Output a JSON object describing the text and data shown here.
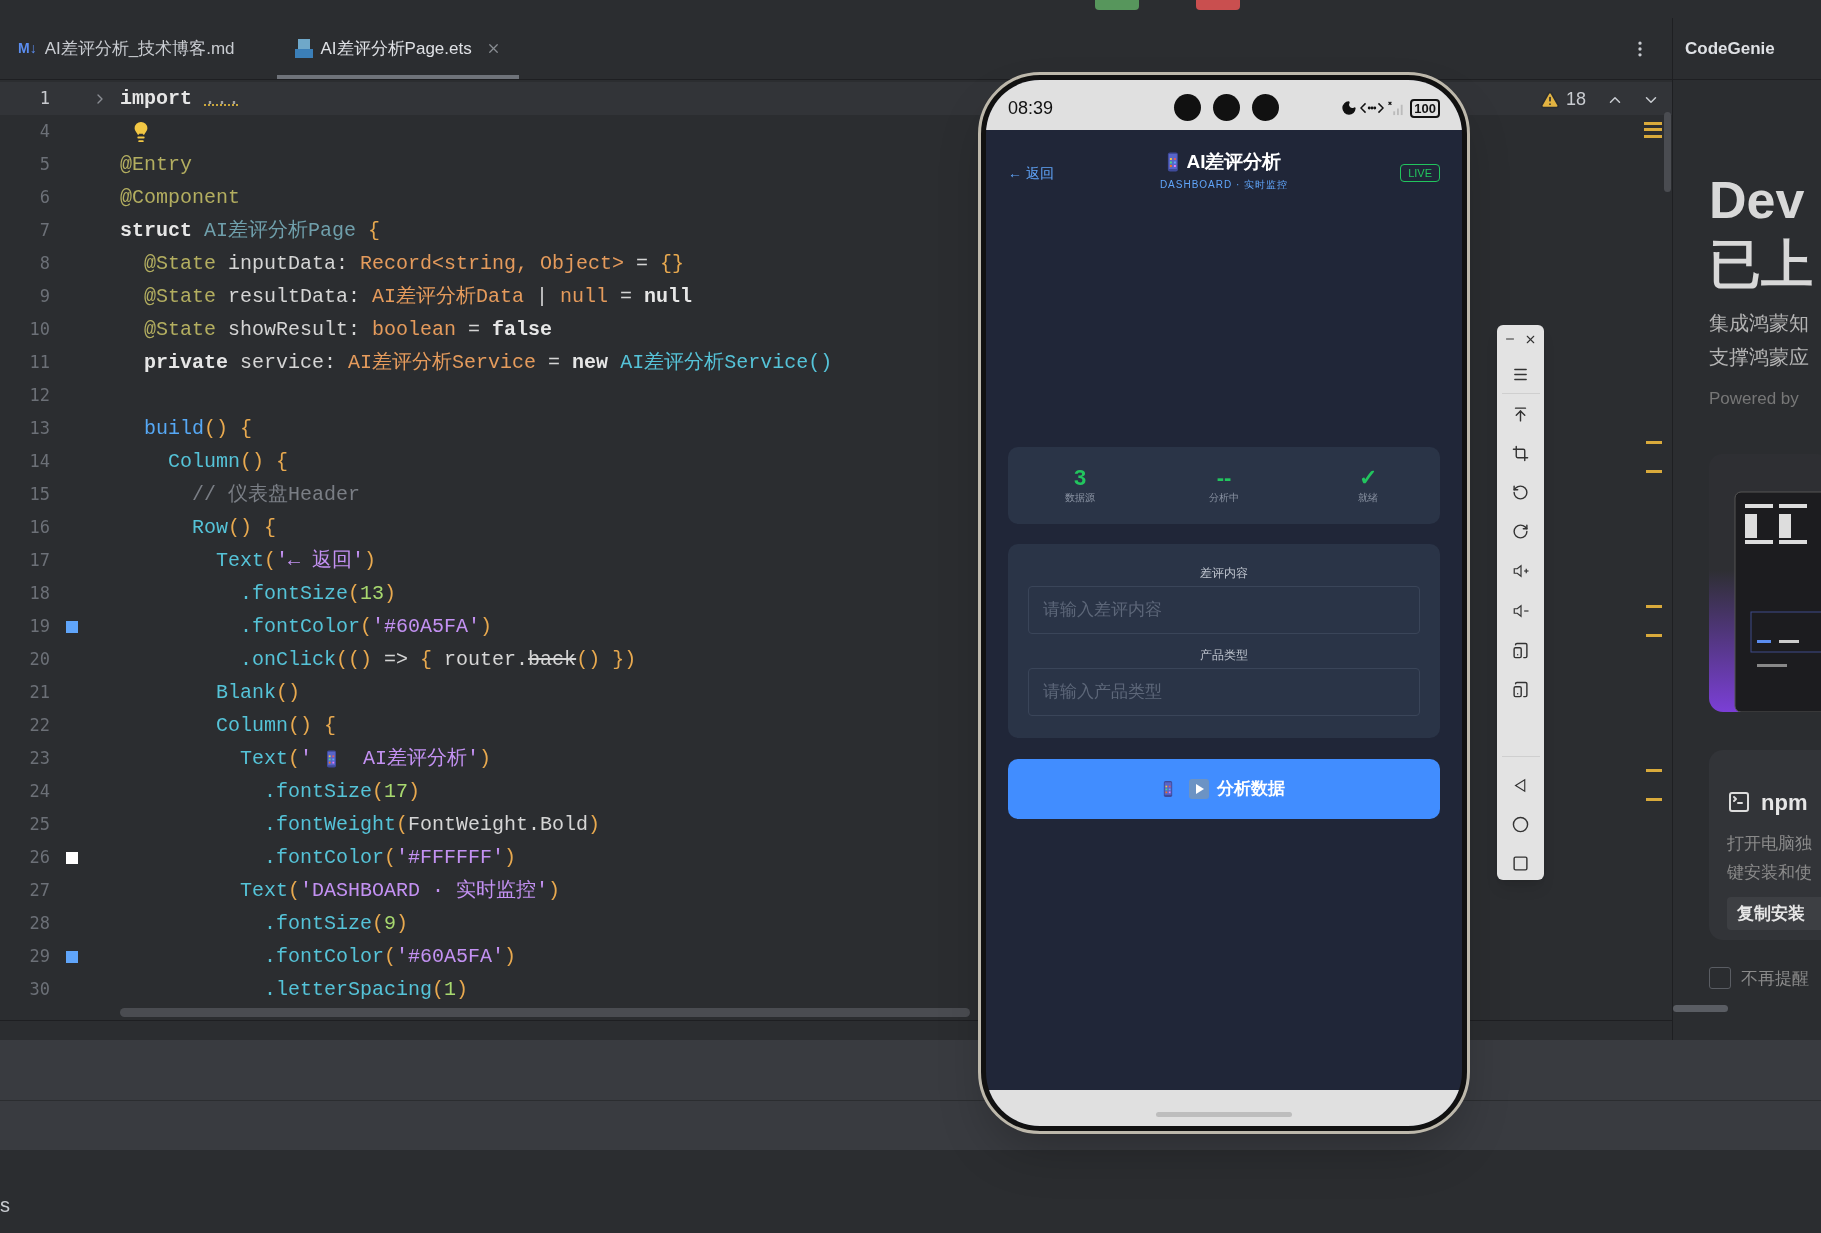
{
  "editor_tabs": [
    {
      "icon_text": "M↓",
      "label": "AI差评分析_技术博客.md",
      "selected": false,
      "closable": false
    },
    {
      "label": "AI差评分析Page.ets",
      "selected": true,
      "closable": true
    }
  ],
  "warnings": {
    "count": "18"
  },
  "code_lines": [
    {
      "number": "1",
      "current": true,
      "kind": "fold",
      "tokens": [
        {
          "kind": "kw",
          "text": "import "
        },
        {
          "kind": "fold",
          "text": "..."
        }
      ]
    },
    {
      "number": "4",
      "current": false,
      "kind": "bulb"
    },
    {
      "number": "5",
      "current": false,
      "tokens": [
        {
          "kind": "dec",
          "text": "@Entry"
        }
      ]
    },
    {
      "number": "6",
      "current": false,
      "tokens": [
        {
          "kind": "dec",
          "text": "@Component"
        }
      ]
    },
    {
      "number": "7",
      "current": false,
      "tokens": [
        {
          "kind": "kw",
          "text": "struct "
        },
        {
          "kind": "cls",
          "text": "AI差评分析Page"
        },
        {
          "kind": "brace",
          "text": " {"
        }
      ]
    },
    {
      "number": "8",
      "current": false,
      "tokens": [
        {
          "kind": "dec",
          "text": "  @State"
        },
        {
          "kind": "txt",
          "text": " inputData: "
        },
        {
          "kind": "type",
          "text": "Record<string, Object>"
        },
        {
          "kind": "txt",
          "text": " = "
        },
        {
          "kind": "brace",
          "text": "{}"
        }
      ]
    },
    {
      "number": "9",
      "current": false,
      "tokens": [
        {
          "kind": "dec",
          "text": "  @State"
        },
        {
          "kind": "txt",
          "text": " resultData: "
        },
        {
          "kind": "type",
          "text": "AI差评分析Data"
        },
        {
          "kind": "txt",
          "text": " | "
        },
        {
          "kind": "type",
          "text": "null"
        },
        {
          "kind": "txt",
          "text": " = "
        },
        {
          "kind": "kw",
          "text": "null"
        }
      ]
    },
    {
      "number": "10",
      "current": false,
      "tokens": [
        {
          "kind": "dec",
          "text": "  @State"
        },
        {
          "kind": "txt",
          "text": " showResult: "
        },
        {
          "kind": "type",
          "text": "boolean"
        },
        {
          "kind": "txt",
          "text": " = "
        },
        {
          "kind": "kw",
          "text": "false"
        }
      ]
    },
    {
      "number": "11",
      "current": false,
      "tokens": [
        {
          "kind": "kw",
          "text": "  private"
        },
        {
          "kind": "txt",
          "text": " service: "
        },
        {
          "kind": "type",
          "text": "AI差评分析Service"
        },
        {
          "kind": "txt",
          "text": " = "
        },
        {
          "kind": "kw",
          "text": "new "
        },
        {
          "kind": "fn",
          "text": "AI差评分析Service()"
        }
      ]
    },
    {
      "number": "12",
      "current": false
    },
    {
      "number": "13",
      "current": false,
      "tokens": [
        {
          "kind": "call",
          "text": "  build"
        },
        {
          "kind": "brace",
          "text": "() {"
        }
      ]
    },
    {
      "number": "14",
      "current": false,
      "tokens": [
        {
          "kind": "fn",
          "text": "    Column"
        },
        {
          "kind": "brace",
          "text": "() {"
        }
      ]
    },
    {
      "number": "15",
      "current": false,
      "tokens": [
        {
          "kind": "cmt",
          "text": "      // 仪表盘Header"
        }
      ]
    },
    {
      "number": "16",
      "current": false,
      "tokens": [
        {
          "kind": "fn",
          "text": "      Row"
        },
        {
          "kind": "brace",
          "text": "() {"
        }
      ]
    },
    {
      "number": "17",
      "current": false,
      "tokens": [
        {
          "kind": "fn",
          "text": "        Text"
        },
        {
          "kind": "brace",
          "text": "("
        },
        {
          "kind": "str",
          "text": "'← 返回'"
        },
        {
          "kind": "brace",
          "text": ")"
        }
      ]
    },
    {
      "number": "18",
      "current": false,
      "tokens": [
        {
          "kind": "fn",
          "text": "          .fontSize"
        },
        {
          "kind": "brace",
          "text": "("
        },
        {
          "kind": "num",
          "text": "13"
        },
        {
          "kind": "brace",
          "text": ")"
        }
      ]
    },
    {
      "number": "19",
      "current": false,
      "kind": "swatch",
      "color": "#60a5fa",
      "tokens": [
        {
          "kind": "fn",
          "text": "          .fontColor"
        },
        {
          "kind": "brace",
          "text": "("
        },
        {
          "kind": "str",
          "text": "'#60A5FA'"
        },
        {
          "kind": "brace",
          "text": ")"
        }
      ]
    },
    {
      "number": "20",
      "current": false,
      "tokens": [
        {
          "kind": "fn",
          "text": "          .onClick"
        },
        {
          "kind": "brace",
          "text": "(() "
        },
        {
          "kind": "txt",
          "text": "=> "
        },
        {
          "kind": "brace",
          "text": "{ "
        },
        {
          "kind": "txt",
          "text": "router."
        },
        {
          "kind": "dep",
          "text": "back"
        },
        {
          "kind": "brace",
          "text": "() })"
        }
      ]
    },
    {
      "number": "21",
      "current": false,
      "tokens": [
        {
          "kind": "fn",
          "text": "        Blank"
        },
        {
          "kind": "brace",
          "text": "()"
        }
      ]
    },
    {
      "number": "22",
      "current": false,
      "tokens": [
        {
          "kind": "fn",
          "text": "        Column"
        },
        {
          "kind": "brace",
          "text": "() {"
        }
      ]
    },
    {
      "number": "23",
      "current": false,
      "tokens": [
        {
          "kind": "fn",
          "text": "          Text"
        },
        {
          "kind": "brace",
          "text": "("
        },
        {
          "kind": "str",
          "text": "' "
        },
        {
          "kind": "emoji"
        },
        {
          "kind": "str",
          "text": "  AI差评分析'"
        },
        {
          "kind": "brace",
          "text": ")"
        }
      ]
    },
    {
      "number": "24",
      "current": false,
      "tokens": [
        {
          "kind": "fn",
          "text": "            .fontSize"
        },
        {
          "kind": "brace",
          "text": "("
        },
        {
          "kind": "num",
          "text": "17"
        },
        {
          "kind": "brace",
          "text": ")"
        }
      ]
    },
    {
      "number": "25",
      "current": false,
      "tokens": [
        {
          "kind": "fn",
          "text": "            .fontWeight"
        },
        {
          "kind": "brace",
          "text": "("
        },
        {
          "kind": "txt",
          "text": "FontWeight.Bold"
        },
        {
          "kind": "brace",
          "text": ")"
        }
      ]
    },
    {
      "number": "26",
      "current": false,
      "kind": "swatch",
      "color": "#ffffff",
      "tokens": [
        {
          "kind": "fn",
          "text": "            .fontColor"
        },
        {
          "kind": "brace",
          "text": "("
        },
        {
          "kind": "str",
          "text": "'#FFFFFF'"
        },
        {
          "kind": "brace",
          "text": ")"
        }
      ]
    },
    {
      "number": "27",
      "current": false,
      "tokens": [
        {
          "kind": "fn",
          "text": "          Text"
        },
        {
          "kind": "brace",
          "text": "("
        },
        {
          "kind": "str",
          "text": "'DASHBOARD · 实时监控'"
        },
        {
          "kind": "brace",
          "text": ")"
        }
      ]
    },
    {
      "number": "28",
      "current": false,
      "tokens": [
        {
          "kind": "fn",
          "text": "            .fontSize"
        },
        {
          "kind": "brace",
          "text": "("
        },
        {
          "kind": "num",
          "text": "9"
        },
        {
          "kind": "brace",
          "text": ")"
        }
      ]
    },
    {
      "number": "29",
      "current": false,
      "kind": "swatch",
      "color": "#60a5fa",
      "tokens": [
        {
          "kind": "fn",
          "text": "            .fontColor"
        },
        {
          "kind": "brace",
          "text": "("
        },
        {
          "kind": "str",
          "text": "'#60A5FA'"
        },
        {
          "kind": "brace",
          "text": ")"
        }
      ]
    },
    {
      "number": "30",
      "current": false,
      "tokens": [
        {
          "kind": "fn",
          "text": "            .letterSpacing"
        },
        {
          "kind": "brace",
          "text": "("
        },
        {
          "kind": "num",
          "text": "1"
        },
        {
          "kind": "brace",
          "text": ")"
        }
      ]
    }
  ],
  "phone": {
    "status_bar": {
      "time": "08:39",
      "battery": "100"
    },
    "header": {
      "back": "← 返回",
      "title": "AI差评分析",
      "subtitle": "DASHBOARD · 实时监控",
      "badge": "LIVE"
    },
    "stats": [
      {
        "value": "3",
        "label": "数据源"
      },
      {
        "value": "--",
        "label": "分析中"
      },
      {
        "value": "✓",
        "label": "就绪"
      }
    ],
    "fields": [
      {
        "label": "差评内容",
        "placeholder": "请输入差评内容"
      },
      {
        "label": "产品类型",
        "placeholder": "请输入产品类型"
      }
    ],
    "button": "分析数据"
  },
  "side_panel": {
    "title": "CodeGenie",
    "headline": [
      "Dev",
      "已上"
    ],
    "description": [
      "集成鸿蒙知",
      "支撑鸿蒙应"
    ],
    "powered_by": "Powered by",
    "promo": {
      "kind": "picture"
    },
    "npm_card": {
      "title": "npm",
      "description": [
        "打开电脑独",
        "键安装和使"
      ],
      "button": "复制安装"
    },
    "dont_remind": {
      "label": "不再提醒",
      "checked": false
    }
  },
  "bottom_panel": {
    "text": "s"
  }
}
